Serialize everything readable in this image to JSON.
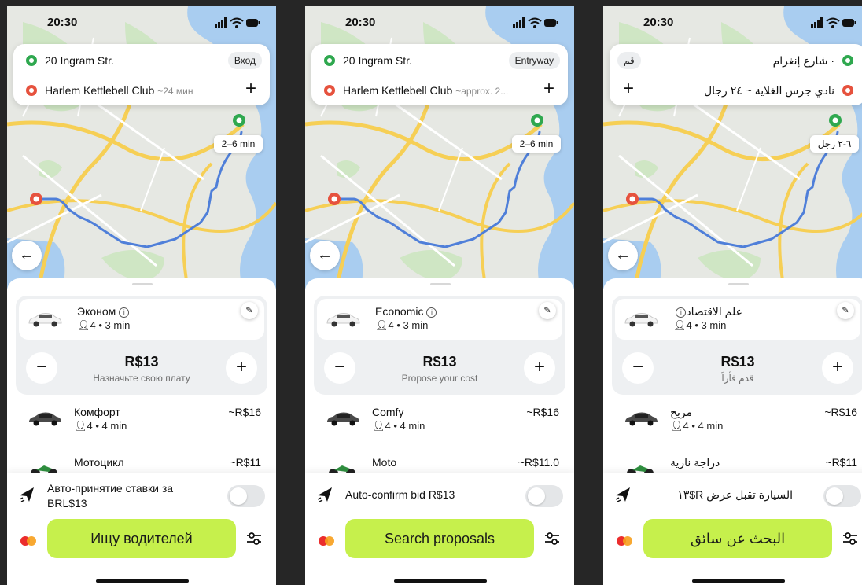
{
  "phones": [
    {
      "status_time": "20:30",
      "from_address": "20 Ingram Str.",
      "from_tag": "Вход",
      "to_address": "Harlem Kettlebell Club",
      "to_eta": "~24 мин",
      "add_stop": "+",
      "map_eta": "2–6 min",
      "back_icon": "←",
      "tariff": {
        "name": "Эконом",
        "info_icon": "i",
        "meta": "4 • 3 min"
      },
      "minus": "−",
      "plus": "+",
      "price": "R$13",
      "price_hint": "Назначьте свою плату",
      "options": [
        {
          "name": "Комфорт",
          "meta": "4 • 4 min",
          "price": "~R$16"
        },
        {
          "name": "Мотоцикл",
          "meta": "",
          "price": "~R$11"
        }
      ],
      "auto_confirm": "Авто-принятие ставки за BRL$13",
      "search_label": "Ищу водителей"
    },
    {
      "status_time": "20:30",
      "from_address": "20 Ingram Str.",
      "from_tag": "Entryway",
      "to_address": "Harlem Kettlebell Club",
      "to_eta": "~approx. 2...",
      "add_stop": "+",
      "map_eta": "2–6 min",
      "back_icon": "←",
      "tariff": {
        "name": "Economic",
        "info_icon": "i",
        "meta": "4 • 3 min"
      },
      "minus": "−",
      "plus": "+",
      "price": "R$13",
      "price_hint": "Propose your cost",
      "options": [
        {
          "name": "Comfy",
          "meta": "4 • 4 min",
          "price": "~R$16"
        },
        {
          "name": "Moto",
          "meta": "",
          "price": "~R$11.0"
        }
      ],
      "auto_confirm": "Auto-confirm bid R$13",
      "search_label": "Search proposals"
    },
    {
      "status_time": "20:30",
      "from_address": "· شارع إنغرام",
      "from_tag": "قم",
      "to_address": "نادي جرس الغلاية ~ ٢٤ رجال",
      "to_eta": "",
      "add_stop": "+",
      "map_eta": "٦-٢ رجل",
      "back_icon": "←",
      "tariff": {
        "name": "علم الاقتصاد",
        "info_icon": "i",
        "meta": "4 • 3 min"
      },
      "minus": "−",
      "plus": "+",
      "price": "R$13",
      "price_hint": "قدم فأراً",
      "options": [
        {
          "name": "مريح",
          "meta": "4 • 4 min",
          "price": "~R$16"
        },
        {
          "name": "دراجة نارية",
          "meta": "",
          "price": "~R$11"
        }
      ],
      "auto_confirm": "السيارة تقبل عرض R$١٣",
      "search_label": "البحث عن سائق"
    }
  ],
  "colors": {
    "accent_green": "#c6f04c",
    "route_blue": "#4f7fd9",
    "origin_green": "#2fa84f",
    "destination_red": "#e6523e",
    "water": "#a9cdf0",
    "road_yellow": "#f6cf55"
  },
  "icons": [
    "signal-icon",
    "wifi-icon",
    "battery-icon",
    "car-icon",
    "moto-icon",
    "plane-icon",
    "mastercard-icon",
    "filter-icon",
    "pencil-icon",
    "info-icon",
    "person-icon",
    "back-arrow-icon"
  ]
}
